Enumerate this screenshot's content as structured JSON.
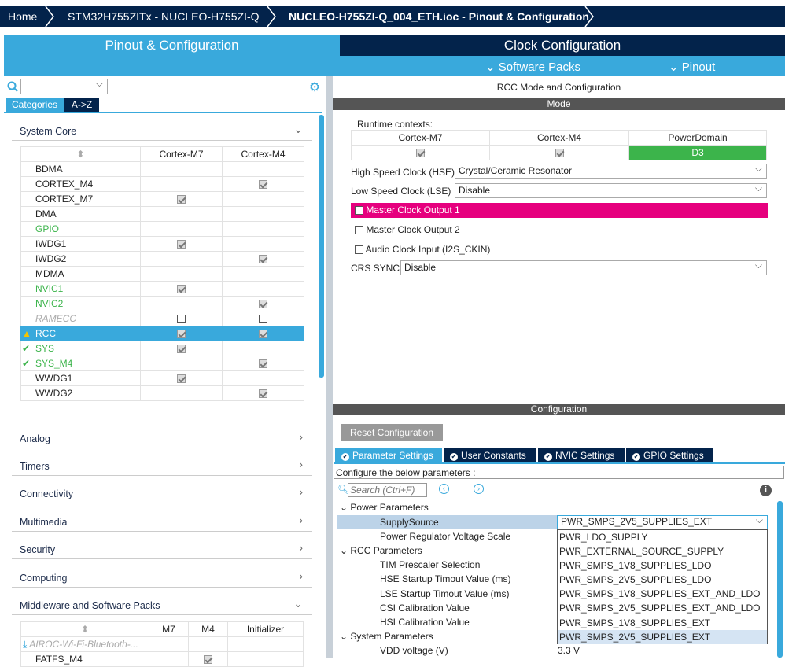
{
  "breadcrumb": {
    "home": "Home",
    "device": "STM32H755ZITx  -  NUCLEO-H755ZI-Q",
    "file": "NUCLEO-H755ZI-Q_004_ETH.ioc - Pinout & Configuration"
  },
  "main_tabs": {
    "pinout": "Pinout & Configuration",
    "clock": "Clock Configuration"
  },
  "menu": {
    "software_packs": "Software Packs",
    "pinout": "Pinout"
  },
  "left": {
    "tabs": [
      "Categories",
      "A->Z"
    ],
    "system_core": "System Core",
    "columns": [
      "Cortex-M7",
      "Cortex-M4"
    ],
    "rows": [
      {
        "name": "BDMA",
        "m7": "",
        "m4": "",
        "style": ""
      },
      {
        "name": "CORTEX_M4",
        "m7": "",
        "m4": "on",
        "style": ""
      },
      {
        "name": "CORTEX_M7",
        "m7": "on",
        "m4": "",
        "style": ""
      },
      {
        "name": "DMA",
        "m7": "",
        "m4": "",
        "style": ""
      },
      {
        "name": "GPIO",
        "m7": "",
        "m4": "",
        "style": "green"
      },
      {
        "name": "IWDG1",
        "m7": "on",
        "m4": "",
        "style": ""
      },
      {
        "name": "IWDG2",
        "m7": "",
        "m4": "on",
        "style": ""
      },
      {
        "name": "MDMA",
        "m7": "",
        "m4": "",
        "style": ""
      },
      {
        "name": "NVIC1",
        "m7": "on",
        "m4": "",
        "style": "green"
      },
      {
        "name": "NVIC2",
        "m7": "",
        "m4": "on",
        "style": "green"
      },
      {
        "name": "RAMECC",
        "m7": "empty",
        "m4": "empty",
        "style": "gray"
      },
      {
        "name": "RCC",
        "m7": "on",
        "m4": "on",
        "style": "sel",
        "icon": "warn"
      },
      {
        "name": "SYS",
        "m7": "on",
        "m4": "",
        "style": "green",
        "icon": "check"
      },
      {
        "name": "SYS_M4",
        "m7": "",
        "m4": "on",
        "style": "green",
        "icon": "check"
      },
      {
        "name": "WWDG1",
        "m7": "on",
        "m4": "",
        "style": ""
      },
      {
        "name": "WWDG2",
        "m7": "",
        "m4": "on",
        "style": ""
      }
    ],
    "categories": [
      "Analog",
      "Timers",
      "Connectivity",
      "Multimedia",
      "Security",
      "Computing",
      "Middleware and Software Packs"
    ],
    "mw_columns": [
      "M7",
      "M4",
      "Initializer"
    ],
    "mw_rows": [
      "AIROC-Wi-Fi-Bluetooth-...",
      "FATFS_M4"
    ]
  },
  "mode": {
    "title": "RCC Mode and Configuration",
    "bar": "Mode",
    "runtime": "Runtime contexts:",
    "ctx_cols": [
      "Cortex-M7",
      "Cortex-M4",
      "PowerDomain"
    ],
    "power_domain": "D3",
    "hse_label": "High Speed Clock (HSE)",
    "hse": "Crystal/Ceramic Resonator",
    "lse_label": "Low Speed Clock (LSE)",
    "lse": "Disable",
    "mco1": "Master Clock Output 1",
    "mco2": "Master Clock Output 2",
    "audio": "Audio Clock Input (I2S_CKIN)",
    "crs_label": "CRS SYNC",
    "crs": "Disable"
  },
  "config": {
    "bar": "Configuration",
    "reset": "Reset Configuration",
    "tabs": [
      "Parameter Settings",
      "User Constants",
      "NVIC Settings",
      "GPIO Settings"
    ],
    "hint": "Configure the below parameters :",
    "search_placeholder": "Search (Ctrl+F)",
    "groups": {
      "power": "Power Parameters",
      "rcc": "RCC Parameters",
      "system": "System Parameters"
    },
    "params": [
      "SupplySource",
      "Power Regulator Voltage Scale",
      "TIM Prescaler Selection",
      "HSE Startup Timout Value (ms)",
      "LSE Startup Timout Value (ms)",
      "CSI Calibration Value",
      "HSI Calibration Value",
      "VDD voltage (V)"
    ],
    "supply_value": "PWR_SMPS_2V5_SUPPLIES_EXT",
    "vdd_value": "3.3 V",
    "options": [
      "PWR_LDO_SUPPLY",
      "PWR_EXTERNAL_SOURCE_SUPPLY",
      "PWR_SMPS_1V8_SUPPLIES_LDO",
      "PWR_SMPS_2V5_SUPPLIES_LDO",
      "PWR_SMPS_1V8_SUPPLIES_EXT_AND_LDO",
      "PWR_SMPS_2V5_SUPPLIES_EXT_AND_LDO",
      "PWR_SMPS_1V8_SUPPLIES_EXT",
      "PWR_SMPS_2V5_SUPPLIES_EXT"
    ]
  },
  "colors": {
    "navy": "#03234b",
    "blue": "#39a9dc",
    "pink": "#e6007e",
    "green": "#3cb44b"
  }
}
